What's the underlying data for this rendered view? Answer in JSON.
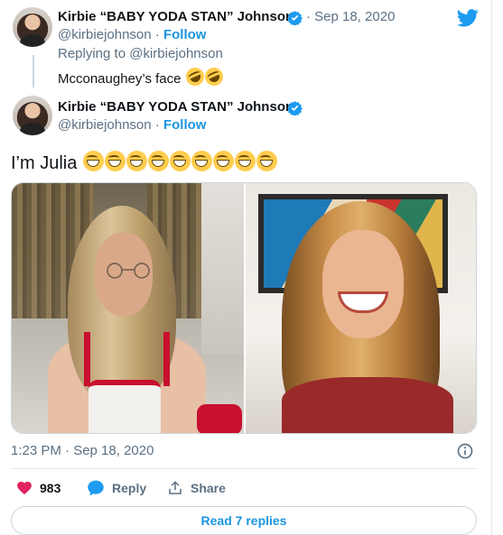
{
  "reply_tweet": {
    "author_name": "Kirbie “BABY YODA STAN” Johnson",
    "handle": "@kirbiejohnson",
    "follow_label": "Follow",
    "date": "· Sep 18, 2020",
    "replying_label": "Replying to",
    "replying_to": "@kirbiejohnson",
    "text": "Mcconaughey’s face",
    "emojis": [
      "rolling-on-floor-laughing",
      "rolling-on-floor-laughing"
    ]
  },
  "main_tweet": {
    "author_name": "Kirbie “BABY YODA STAN” Johnson",
    "handle": "@kirbiejohnson",
    "follow_label": "Follow",
    "text": "I’m Julia",
    "emojis": [
      "grinning-face-with-smiling-eyes",
      "grinning-face-with-smiling-eyes",
      "grinning-face-with-smiling-eyes",
      "grinning-face-with-smiling-eyes",
      "grinning-face-with-smiling-eyes",
      "grinning-face-with-smiling-eyes",
      "grinning-face-with-smiling-eyes",
      "grinning-face-with-smiling-eyes",
      "grinning-face-with-smiling-eyes"
    ],
    "timestamp": "1:23 PM · Sep 18, 2020",
    "likes": "983",
    "reply_label": "Reply",
    "share_label": "Share",
    "read_replies_label": "Read 7 replies"
  },
  "icons": {
    "brand": "twitter-bird-icon",
    "verified": "verified-badge-icon",
    "like": "heart-icon",
    "reply": "speech-bubble-icon",
    "share": "share-icon",
    "info": "info-icon"
  },
  "colors": {
    "twitter_blue": "#1b95e0",
    "like_pink": "#e0245e",
    "muted_text": "#5b7083",
    "border": "#e1e8ed"
  }
}
